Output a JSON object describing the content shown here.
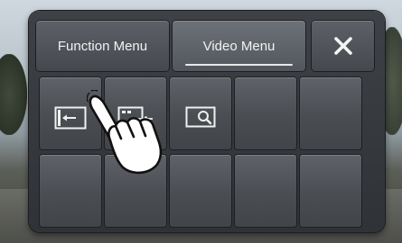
{
  "tabs": {
    "function_menu": "Function Menu",
    "video_menu": "Video Menu",
    "close": "✕"
  },
  "grid": {
    "row1": [
      {
        "icon": "aspect-ratio-icon"
      },
      {
        "icon": "picture-adjust-icon"
      },
      {
        "icon": "zoom-icon"
      },
      {
        "icon": "empty"
      },
      {
        "icon": "empty"
      }
    ],
    "row2": [
      {
        "icon": "empty"
      },
      {
        "icon": "empty"
      },
      {
        "icon": "empty"
      },
      {
        "icon": "empty"
      },
      {
        "icon": "empty"
      }
    ]
  },
  "colors": {
    "panel": "#3a3d42",
    "button": "#55585e",
    "text": "#f2f2f2",
    "accent_underline": "#e9e9e9"
  }
}
